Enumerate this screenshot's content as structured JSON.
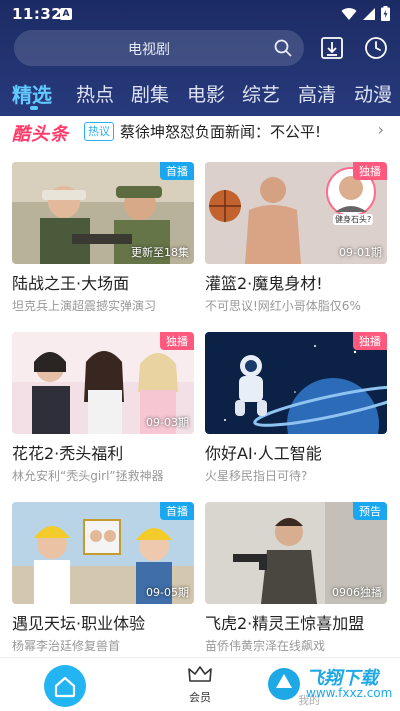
{
  "status": {
    "time": "11:32",
    "notif": "A"
  },
  "search": {
    "placeholder": "电视剧"
  },
  "tabs": [
    "精选",
    "热点",
    "剧集",
    "电影",
    "综艺",
    "高清",
    "动漫"
  ],
  "news": {
    "brand": "酷头条",
    "tag": "热议",
    "headline": "蔡徐坤怒怼负面新闻：不公平!"
  },
  "cards": [
    {
      "title": "陆战之王·大场面",
      "subtitle": "坦克兵上演超震撼实弹演习",
      "badge": "首播",
      "overlay": "更新至18集"
    },
    {
      "title": "灌篮2·魔鬼身材!",
      "subtitle": "不可思议!网红小哥体脂仅6%",
      "badge": "独播",
      "overlay": "09-01期"
    },
    {
      "title": "花花2·秃头福利",
      "subtitle": "林允安利“秃头girl”拯救神器",
      "badge": "独播",
      "overlay": "09-03期"
    },
    {
      "title": "你好AI·人工智能",
      "subtitle": "火星移民指日可待?",
      "badge": "独播",
      "overlay": ""
    },
    {
      "title": "遇见天坛·职业体验",
      "subtitle": "杨幂李治廷修复兽首",
      "badge": "首播",
      "overlay": "09-05期"
    },
    {
      "title": "飞虎2·精灵王惊喜加盟",
      "subtitle": "苗侨伟黄宗泽在线飙戏",
      "badge": "预告",
      "overlay": "0906独播"
    }
  ],
  "thumb_texts": {
    "bubble": "健身石头?"
  },
  "bottom_nav": {
    "vip": "会员",
    "mine": "我的"
  },
  "watermark": {
    "title": "飞翔下载",
    "url": "www.fxxz.com"
  },
  "colors": {
    "header": "#1c2b64",
    "accent": "#62c9ff",
    "badge_blue": "#1aa7f0",
    "badge_pink": "#ff5a7e",
    "brand_pink": "#ff3b6b"
  }
}
